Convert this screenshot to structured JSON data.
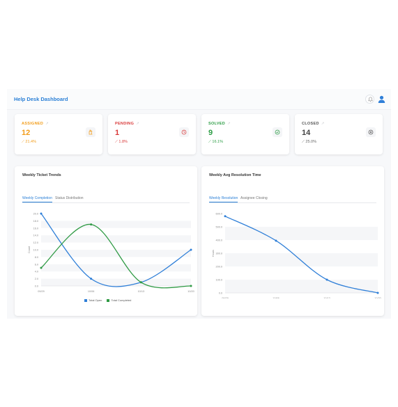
{
  "header": {
    "title": "Help Desk Dashboard"
  },
  "cards": [
    {
      "label": "ASSIGNED",
      "value": "12",
      "pct": "21.4%",
      "color": "#f29d1b",
      "icon": "hand-icon"
    },
    {
      "label": "PENDING",
      "value": "1",
      "pct": "1.8%",
      "color": "#d93a3a",
      "icon": "clock-icon"
    },
    {
      "label": "SOLVED",
      "value": "9",
      "pct": "16.1%",
      "color": "#2c9d45",
      "icon": "check-circle-icon"
    },
    {
      "label": "CLOSED",
      "value": "14",
      "pct": "25.0%",
      "color": "#555555",
      "icon": "close-circle-icon"
    }
  ],
  "panels": {
    "left": {
      "title": "Weekly Ticket Trends",
      "tabs": [
        "Weekly Completion",
        "Status Distribution"
      ]
    },
    "right": {
      "title": "Weekly Avg Resolution Time",
      "tabs": [
        "Weekly Resolution",
        "Assignee Closing"
      ]
    }
  },
  "chart_data": [
    {
      "type": "line",
      "categories": [
        "09/29",
        "10/06",
        "10/13",
        "10/20"
      ],
      "ylabel": "Count",
      "ylim": [
        0,
        20
      ],
      "yticks": [
        0,
        2,
        4,
        6,
        8,
        10,
        12,
        14,
        16,
        18,
        20
      ],
      "series": [
        {
          "name": "Total Open",
          "values": [
            20,
            2,
            1,
            10
          ],
          "color": "#2f7fd8"
        },
        {
          "name": "Total Completed",
          "values": [
            5,
            17,
            1,
            0
          ],
          "color": "#2f9a44"
        }
      ],
      "legend": "bottom"
    },
    {
      "type": "line",
      "categories": [
        "09/29",
        "10/06",
        "10/13",
        "10/20"
      ],
      "ylabel": "Hours",
      "ylim": [
        0,
        600
      ],
      "yticks": [
        0,
        100,
        200,
        300,
        400,
        500,
        600
      ],
      "series": [
        {
          "values": [
            580,
            395,
            100,
            0
          ],
          "color": "#2f7fd8"
        }
      ]
    }
  ]
}
